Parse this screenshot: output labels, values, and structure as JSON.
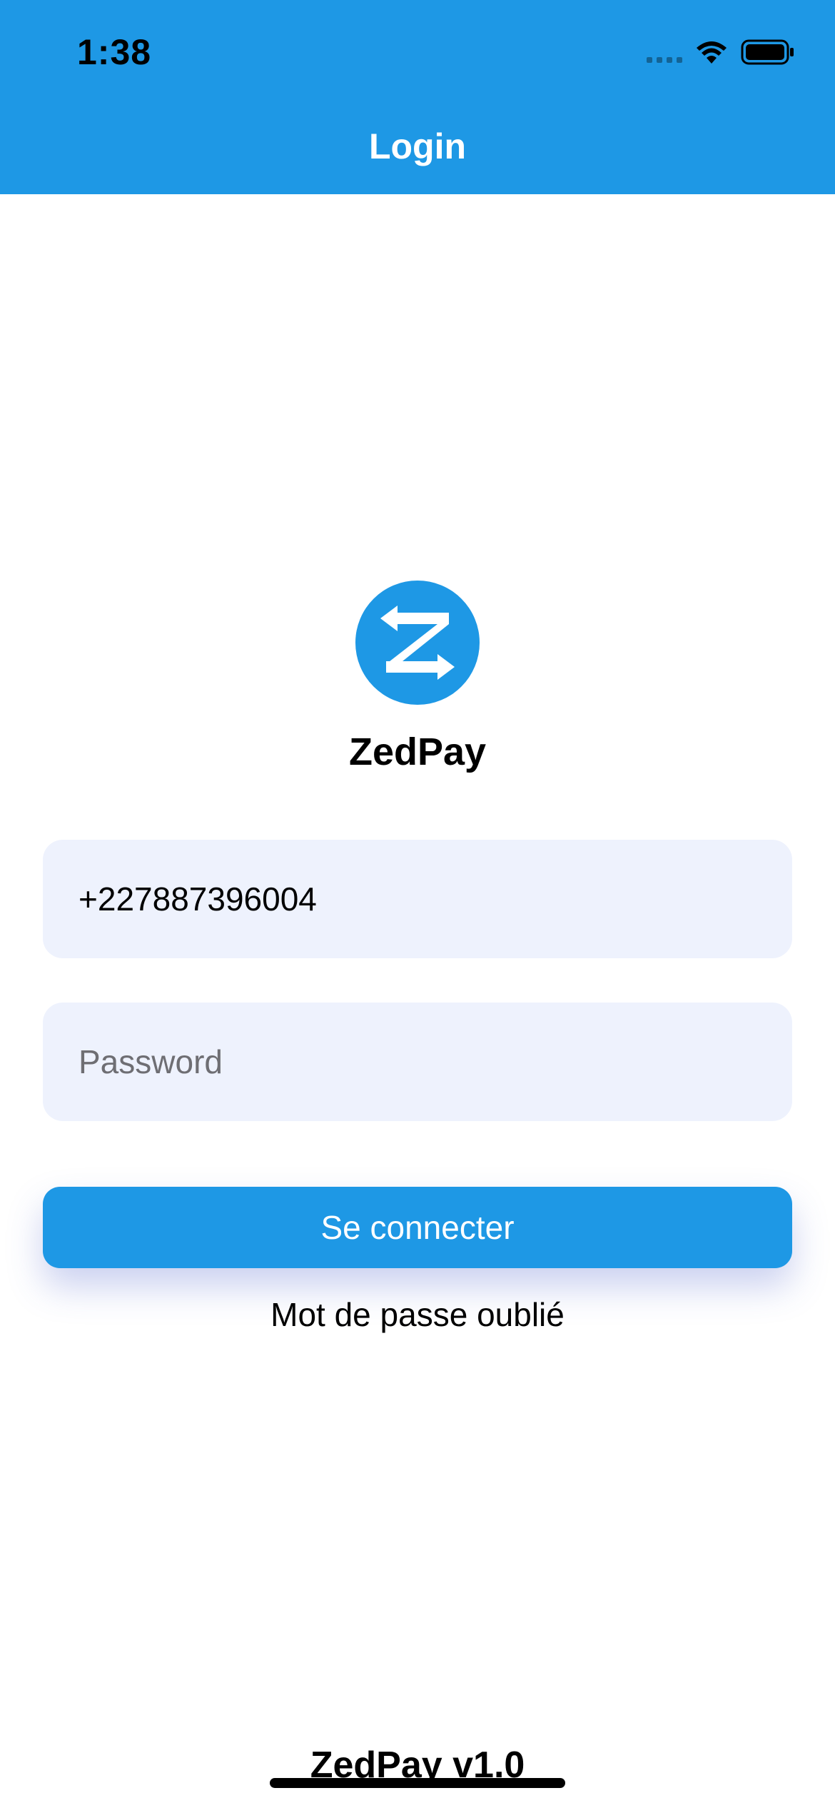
{
  "status_bar": {
    "time": "1:38"
  },
  "header": {
    "title": "Login"
  },
  "brand": {
    "name": "ZedPay",
    "logo_icon": "zedpay-z-arrows-logo"
  },
  "form": {
    "phone_value": "+227887396004",
    "password_placeholder": "Password",
    "submit_label": "Se connecter",
    "forgot_label": "Mot de passe oublié"
  },
  "footer": {
    "version": "ZedPay v1.0"
  },
  "colors": {
    "primary": "#1E98E5",
    "field_background": "#EEF2FD",
    "text": "#000000",
    "placeholder": "#6E6E73"
  }
}
